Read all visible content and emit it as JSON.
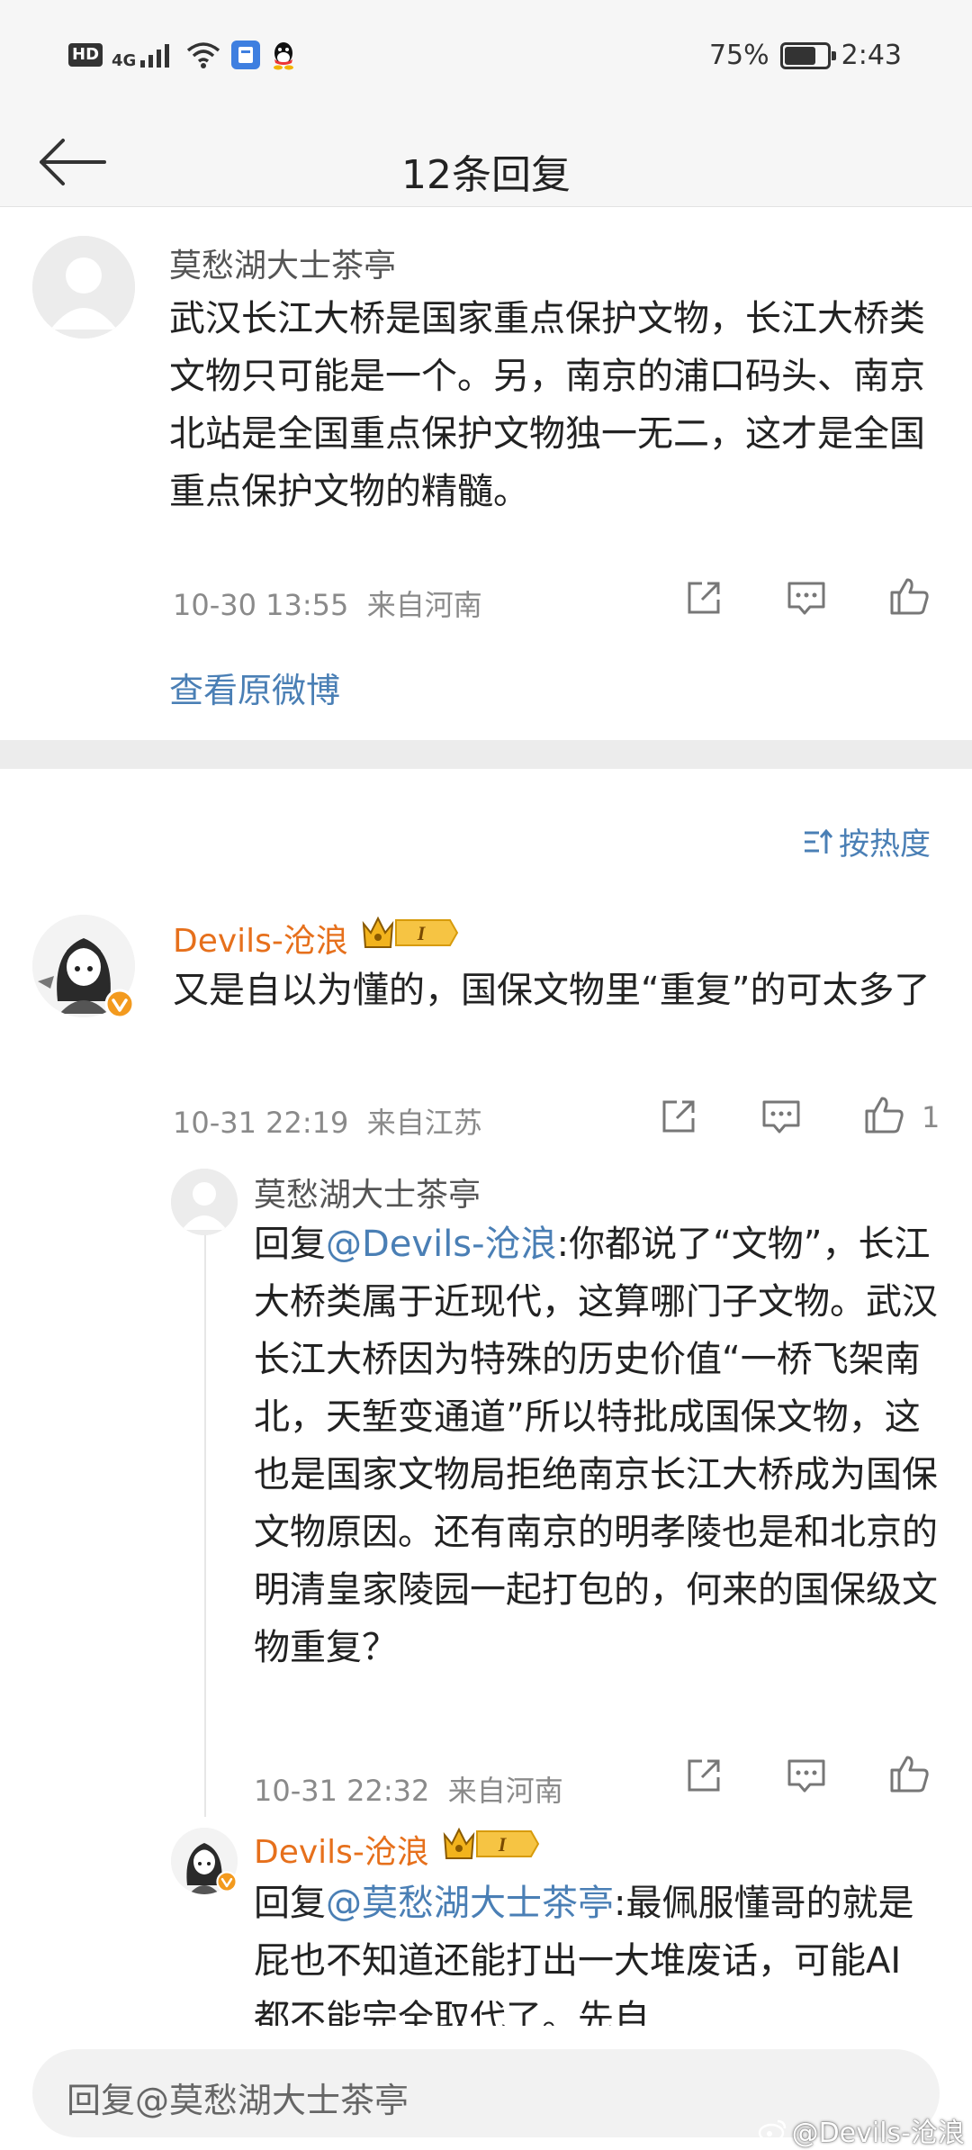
{
  "status_bar": {
    "network_hd": "HD",
    "network_4g": "4G",
    "battery_percent": "75%",
    "battery_level": 0.75,
    "time": "2:43"
  },
  "header": {
    "title": "12条回复"
  },
  "root_comment": {
    "username": "莫愁湖大士茶亭",
    "text": "武汉长江大桥是国家重点保护文物，长江大桥类文物只可能是一个。另，南京的浦口码头、南京北站是全国重点保护文物独一无二，这才是全国重点保护文物的精髓。",
    "timestamp": "10-30 13:55",
    "location": "来自河南",
    "view_original": "查看原微博"
  },
  "sort": {
    "label": "按热度"
  },
  "comments": [
    {
      "username": "Devils-沧浪",
      "badge_level": "I",
      "text": "又是自以为懂的，国保文物里“重复”的可太多了",
      "timestamp": "10-31 22:19",
      "location": "来自江苏",
      "like_count": "1"
    }
  ],
  "replies": [
    {
      "username": "莫愁湖大士茶亭",
      "reply_prefix": "回复",
      "mention": "@Devils-沧浪",
      "text": ":你都说了“文物”，长江大桥类属于近现代，这算哪门子文物。武汉长江大桥因为特殊的历史价值“一桥飞架南北，天堑变通道”所以特批成国保文物，这也是国家文物局拒绝南京长江大桥成为国保文物原因。还有南京的明孝陵也是和北京的明清皇家陵园一起打包的，何来的国保级文物重复？",
      "timestamp": "10-31 22:32",
      "location": "来自河南"
    },
    {
      "username": "Devils-沧浪",
      "badge_level": "I",
      "reply_prefix": "回复",
      "mention": "@莫愁湖大士茶亭",
      "text": ":最佩服懂哥的就是屁也不知道还能打出一大堆废话，可能AI都不能完全取代了。先自"
    }
  ],
  "reply_input": {
    "placeholder": "回复@莫愁湖大士茶亭"
  },
  "watermark": {
    "text": "@Devils-沧浪"
  },
  "colors": {
    "link": "#4a7fb5",
    "username_vip": "#e6701c",
    "meta_gray": "#8a8a8a",
    "header_bg": "#f6f6f6"
  }
}
